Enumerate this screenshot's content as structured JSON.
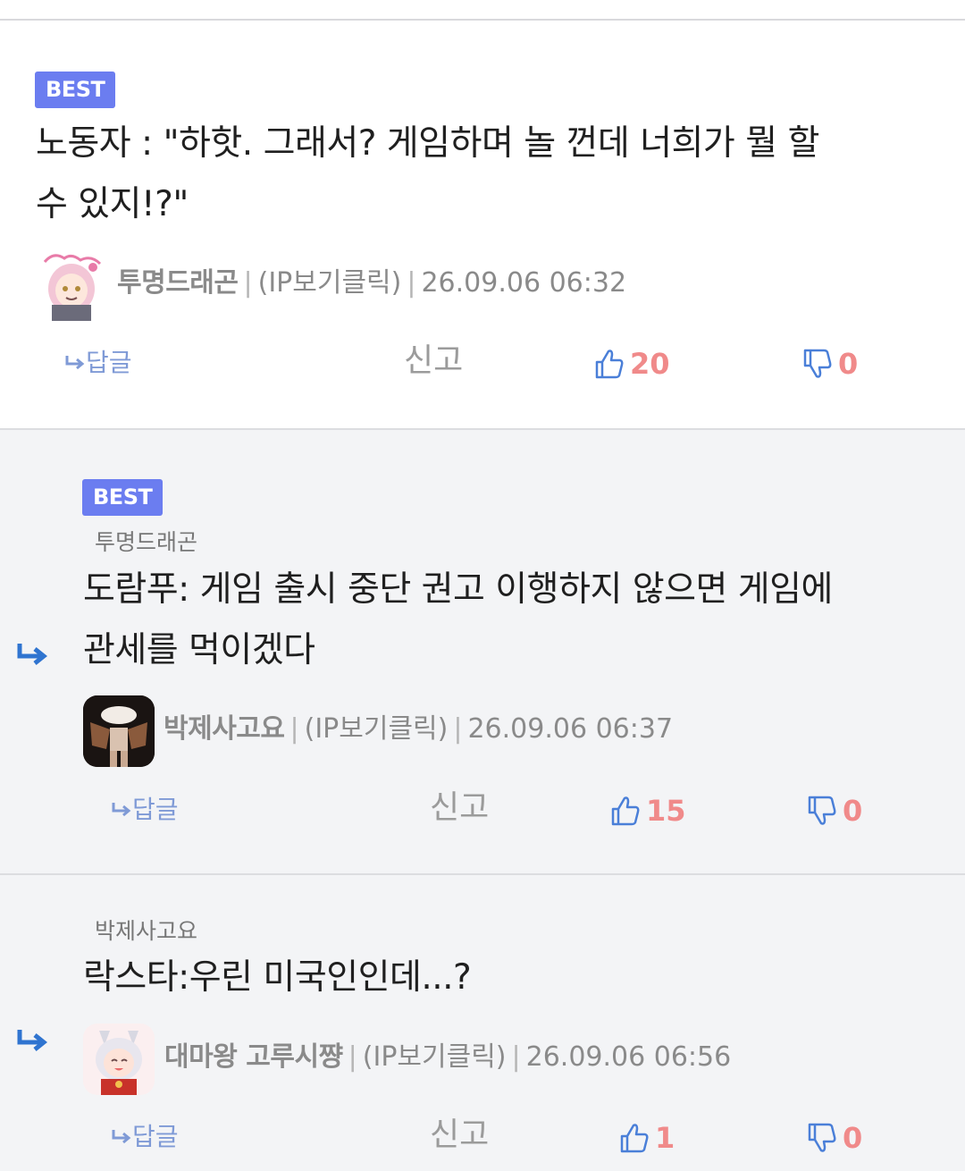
{
  "comments": [
    {
      "badge": "BEST",
      "text_lines": [
        "노동자 : \"하핫. 그래서? 게임하며 놀 껀데 너희가 뭘 할",
        "수 있지!?\""
      ],
      "avatar_icon": "anime-girl-avatar-icon",
      "nickname": "투명드래곤",
      "ip": "(IP보기클릭)",
      "timestamp": "26.09.06 06:32",
      "reply_label": "답글",
      "report_label": "신고",
      "likes": "20",
      "dislikes": "0"
    },
    {
      "badge": "BEST",
      "parent": "투명드래곤",
      "text_lines": [
        "도람푸: 게임 출시 중단 권고 이행하지 않으면 게임에",
        "관세를 먹이겠다"
      ],
      "avatar_icon": "character-avatar-icon",
      "nickname": "박제사고요",
      "ip": "(IP보기클릭)",
      "timestamp": "26.09.06 06:37",
      "reply_label": "답글",
      "report_label": "신고",
      "likes": "15",
      "dislikes": "0"
    },
    {
      "parent": "박제사고요",
      "text_lines": [
        "락스타:우린 미국인인데...?"
      ],
      "avatar_icon": "horse-girl-avatar-icon",
      "nickname": "대마왕 고루시쨩",
      "ip": "(IP보기클릭)",
      "timestamp": "26.09.06 06:56",
      "reply_label": "답글",
      "report_label": "신고",
      "likes": "1",
      "dislikes": "0"
    }
  ],
  "colors": {
    "badge": "#6b7df0",
    "like_count": "#f08a8a",
    "thumb_icon": "#4a7fd8",
    "reply_arrow": "#2f74d0",
    "reply_button": "#7f9ad6"
  }
}
